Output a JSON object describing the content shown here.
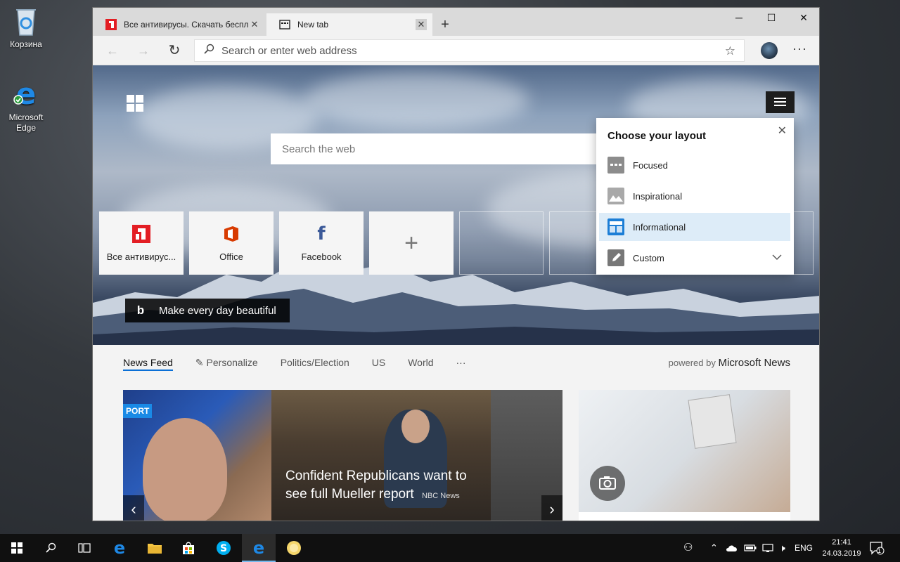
{
  "desktop": {
    "icons": [
      {
        "label": "Корзина",
        "icon": "recycle-bin-icon"
      },
      {
        "label": "Microsoft Edge",
        "icon": "edge-icon"
      }
    ]
  },
  "browser": {
    "tabs": [
      {
        "title": "Все антивирусы. Скачать беспл",
        "icon": "antivirus-logo-icon",
        "active": false
      },
      {
        "title": "New tab",
        "icon": "tab-page-icon",
        "active": true
      }
    ],
    "new_tab_symbol": "+",
    "window_controls": {
      "minimize": "─",
      "maximize": "☐",
      "close": "✕"
    },
    "nav": {
      "back": "←",
      "forward": "→",
      "refresh": "↻"
    },
    "address_placeholder": "Search or enter web address",
    "more_symbol": "···"
  },
  "ntp": {
    "search_placeholder": "Search the web",
    "tiles": [
      {
        "label": "Все антивирус...",
        "icon": "antivirus-logo-icon"
      },
      {
        "label": "Office",
        "icon": "office-icon"
      },
      {
        "label": "Facebook",
        "icon": "facebook-icon"
      },
      {
        "label": "+",
        "icon": "add-icon"
      }
    ],
    "bing_symbol": "b",
    "bing_caption": "Make every day beautiful",
    "layout_panel": {
      "title": "Choose your layout",
      "close": "✕",
      "options": [
        {
          "label": "Focused",
          "selected": false
        },
        {
          "label": "Inspirational",
          "selected": false
        },
        {
          "label": "Informational",
          "selected": true
        },
        {
          "label": "Custom",
          "selected": false
        }
      ],
      "custom_chevron": "⌄"
    }
  },
  "news": {
    "tabs": [
      "News Feed",
      "Personalize",
      "Politics/Election",
      "US",
      "World",
      "···"
    ],
    "active_tab": "News Feed",
    "powered_prefix": "powered by",
    "powered_brand": "Microsoft News",
    "card_tag": "PORT",
    "headline": "Confident Republicans want to see full Mueller report",
    "headline_source": "NBC News",
    "prev_arrow": "‹",
    "next_arrow": "›"
  },
  "taskbar": {
    "language": "ENG",
    "time": "21:41",
    "date": "24.03.2019",
    "notification_count": "1"
  },
  "colors": {
    "accent": "#0a6fd6",
    "office_red": "#d83b01",
    "facebook_blue": "#3b5998",
    "antivirus_red": "#e31e24",
    "edge_blue": "#1e88e5"
  }
}
